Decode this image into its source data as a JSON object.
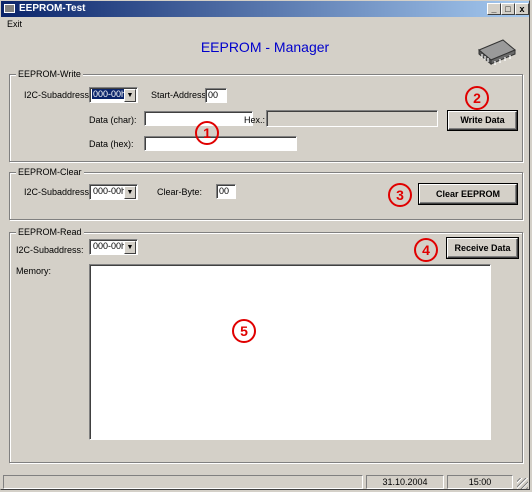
{
  "window": {
    "title": "EEPROM-Test",
    "minimize": "_",
    "maximize": "□",
    "close": "x"
  },
  "menu": {
    "exit": "Exit"
  },
  "header": {
    "title": "EEPROM - Manager"
  },
  "write": {
    "legend": "EEPROM-Write",
    "subaddress_label": "I2C-Subaddress:",
    "subaddress_value": "000-00h",
    "start_label": "Start-Address:",
    "start_value": "00",
    "char_label": "Data (char):",
    "char_value": "",
    "hex_label": "Hex.:",
    "hexdata_label": "Data (hex):",
    "hexdata_value": "",
    "button": "Write Data"
  },
  "clear": {
    "legend": "EEPROM-Clear",
    "subaddress_label": "I2C-Subaddress:",
    "subaddress_value": "000-00h",
    "byte_label": "Clear-Byte:",
    "byte_value": "00",
    "button": "Clear EEPROM"
  },
  "read": {
    "legend": "EEPROM-Read",
    "subaddress_label": "I2C-Subaddress:",
    "subaddress_value": "000-00h",
    "memory_label": "Memory:",
    "button": "Receive Data"
  },
  "callouts": [
    "1",
    "2",
    "3",
    "4",
    "5"
  ],
  "status": {
    "date": "31.10.2004",
    "time": "15:00"
  },
  "colors": {
    "title_blue": "#0000cc",
    "callout_red": "#e00000",
    "face": "#d4d0c8"
  }
}
